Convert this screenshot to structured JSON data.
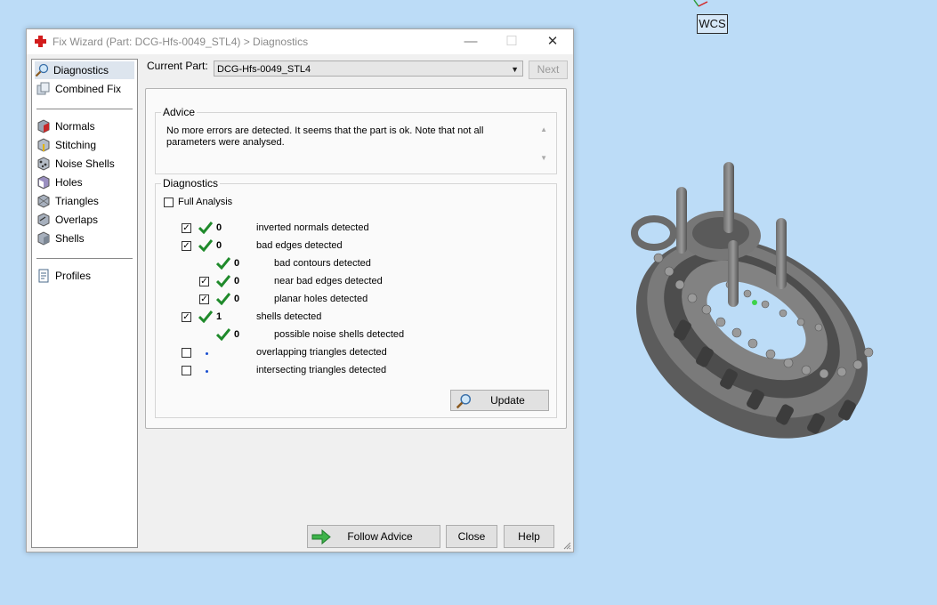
{
  "window": {
    "title": "Fix Wizard (Part: DCG-Hfs-0049_STL4) > Diagnostics",
    "controls": {
      "minimize": "—",
      "maximize": "☐",
      "close": "✕"
    }
  },
  "viewport": {
    "wcs_label": "WCS"
  },
  "sidebar": {
    "items": [
      {
        "label": "Diagnostics",
        "icon": "magnifier-icon"
      },
      {
        "label": "Combined Fix",
        "icon": "combined-fix-icon"
      },
      {
        "label": "Normals",
        "icon": "normals-icon"
      },
      {
        "label": "Stitching",
        "icon": "stitching-icon"
      },
      {
        "label": "Noise Shells",
        "icon": "noise-shells-icon"
      },
      {
        "label": "Holes",
        "icon": "holes-icon"
      },
      {
        "label": "Triangles",
        "icon": "triangles-icon"
      },
      {
        "label": "Overlaps",
        "icon": "overlaps-icon"
      },
      {
        "label": "Shells",
        "icon": "shells-icon"
      },
      {
        "label": "Profiles",
        "icon": "profiles-icon"
      }
    ]
  },
  "header": {
    "current_part_label": "Current Part:",
    "current_part_value": "DCG-Hfs-0049_STL4",
    "next_label": "Next"
  },
  "advice": {
    "title": "Advice",
    "text": "No more errors are detected. It seems that the part is ok. Note that not all parameters were analysed."
  },
  "diagnostics": {
    "title": "Diagnostics",
    "full_analysis_label": "Full Analysis",
    "rows": [
      {
        "checked": true,
        "status": "ok",
        "count": "0",
        "text": "inverted normals detected"
      },
      {
        "checked": true,
        "status": "ok",
        "count": "0",
        "text": "bad edges detected"
      },
      {
        "checked": null,
        "status": "ok",
        "count": "0",
        "text": "bad contours detected"
      },
      {
        "checked": true,
        "status": "ok",
        "count": "0",
        "text": "near bad edges detected"
      },
      {
        "checked": true,
        "status": "ok",
        "count": "0",
        "text": "planar holes detected"
      },
      {
        "checked": true,
        "status": "ok",
        "count": "1",
        "text": "shells detected"
      },
      {
        "checked": null,
        "status": "ok",
        "count": "0",
        "text": "possible noise shells detected"
      },
      {
        "checked": false,
        "status": "pending",
        "count": "",
        "text": "overlapping triangles detected"
      },
      {
        "checked": false,
        "status": "pending",
        "count": "",
        "text": "intersecting triangles detected"
      }
    ],
    "update_label": "Update"
  },
  "footer": {
    "follow_advice_label": "Follow Advice",
    "close_label": "Close",
    "help_label": "Help"
  },
  "colors": {
    "check_green": "#1f8a2b",
    "title_red": "#d21c1c",
    "viewport_bg": "#bcdcf7"
  }
}
